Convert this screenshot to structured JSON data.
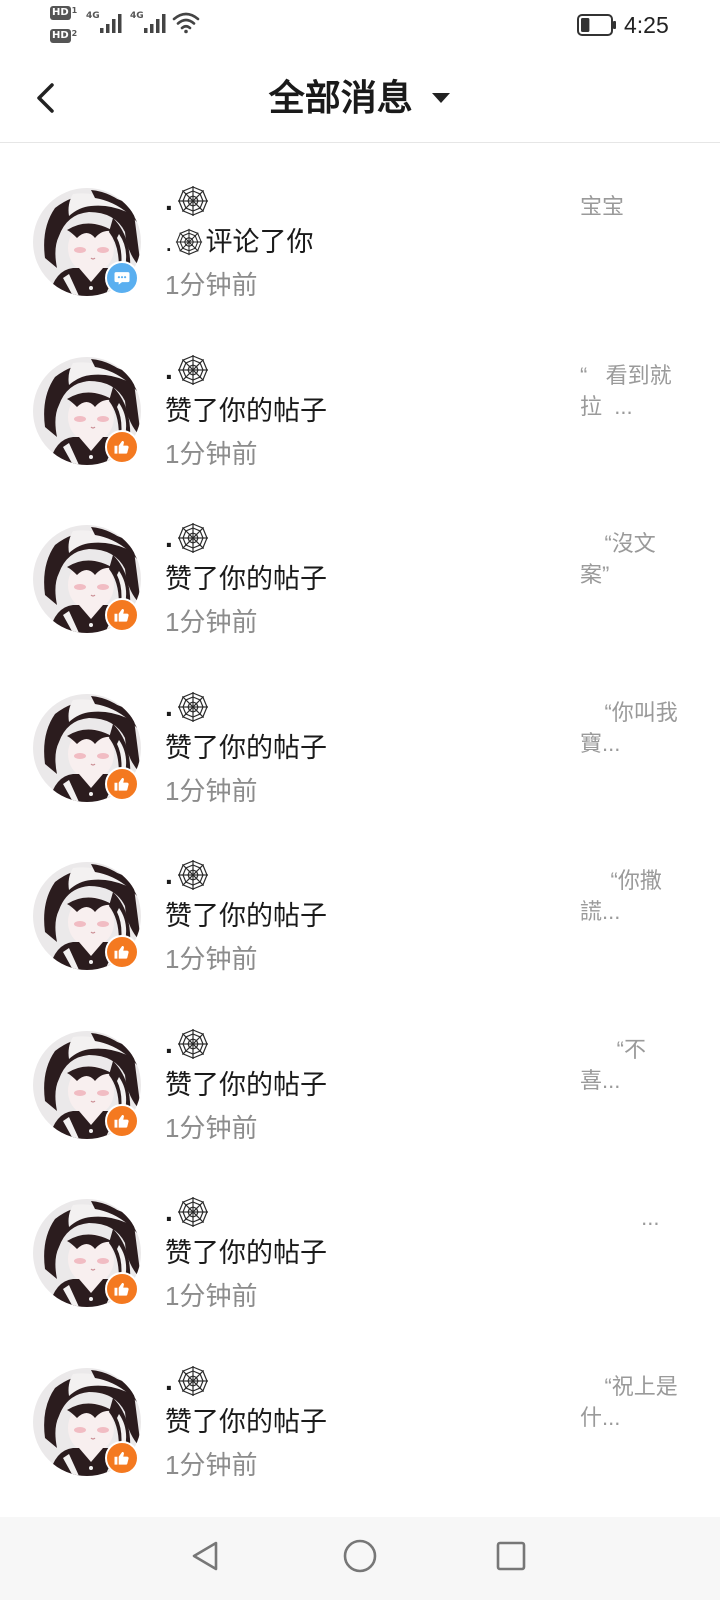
{
  "status_bar": {
    "sim1": {
      "label": "HD",
      "index": "1",
      "network": "4G"
    },
    "sim2": {
      "label": "HD",
      "index": "2",
      "network": "4G"
    },
    "wifi_icon": "wifi-icon",
    "battery_icon": "battery-icon",
    "battery_level": 0.3,
    "time": "4:25"
  },
  "header": {
    "back_icon": "chevron-left-icon",
    "title": "全部消息",
    "dropdown_icon": "caret-down-icon"
  },
  "colors": {
    "comment_badge": "#5aaff0",
    "like_badge": "#f47920",
    "text": "#1a1a1a",
    "secondary_text": "#8c8c8c"
  },
  "messages": [
    {
      "name": ".",
      "name_icon": "spider-web-icon",
      "action_actor": ".",
      "action_actor_icon": "spider-web-icon",
      "action": "评论了你",
      "time": "1分钟前",
      "badge_icon": "comment-icon",
      "preview": "宝宝"
    },
    {
      "name": ".",
      "name_icon": "spider-web-icon",
      "action": "赞了你的帖子",
      "time": "1分钟前",
      "badge_icon": "like-icon",
      "preview": "“   看到就\n拉  ..."
    },
    {
      "name": ".",
      "name_icon": "spider-web-icon",
      "action": "赞了你的帖子",
      "time": "1分钟前",
      "badge_icon": "like-icon",
      "preview": "    “沒文\n案”"
    },
    {
      "name": ".",
      "name_icon": "spider-web-icon",
      "action": "赞了你的帖子",
      "time": "1分钟前",
      "badge_icon": "like-icon",
      "preview": "    “你叫我\n寶..."
    },
    {
      "name": ".",
      "name_icon": "spider-web-icon",
      "action": "赞了你的帖子",
      "time": "1分钟前",
      "badge_icon": "like-icon",
      "preview": "     “你撒\n謊..."
    },
    {
      "name": ".",
      "name_icon": "spider-web-icon",
      "action": "赞了你的帖子",
      "time": "1分钟前",
      "badge_icon": "like-icon",
      "preview": "      “不\n喜..."
    },
    {
      "name": ".",
      "name_icon": "spider-web-icon",
      "action": "赞了你的帖子",
      "time": "1分钟前",
      "badge_icon": "like-icon",
      "preview": "          ..."
    },
    {
      "name": ".",
      "name_icon": "spider-web-icon",
      "action": "赞了你的帖子",
      "time": "1分钟前",
      "badge_icon": "like-icon",
      "preview": "    “祝上是\n什..."
    }
  ],
  "nav_bar": {
    "back_icon": "triangle-back-icon",
    "home_icon": "circle-home-icon",
    "recents_icon": "square-recents-icon"
  }
}
